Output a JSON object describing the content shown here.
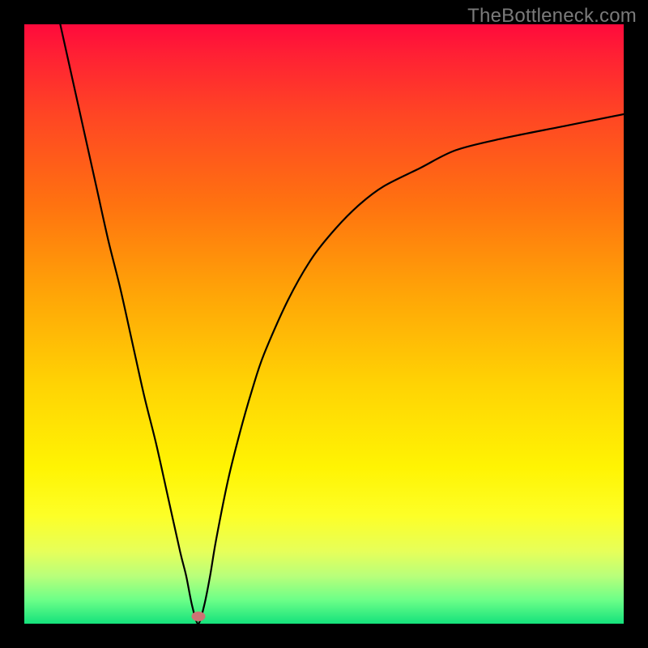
{
  "watermark": "TheBottleneck.com",
  "chart_data": {
    "type": "line",
    "title": "",
    "xlabel": "",
    "ylabel": "",
    "xlim": [
      0,
      100
    ],
    "ylim": [
      0,
      100
    ],
    "background": {
      "gradient": "vertical",
      "stops": [
        {
          "pos": 0.0,
          "color": "#ff0a3c"
        },
        {
          "pos": 0.05,
          "color": "#ff2034"
        },
        {
          "pos": 0.15,
          "color": "#ff4524"
        },
        {
          "pos": 0.3,
          "color": "#ff7210"
        },
        {
          "pos": 0.45,
          "color": "#ffa507"
        },
        {
          "pos": 0.6,
          "color": "#ffd304"
        },
        {
          "pos": 0.74,
          "color": "#fff403"
        },
        {
          "pos": 0.82,
          "color": "#fdff27"
        },
        {
          "pos": 0.88,
          "color": "#e6ff5a"
        },
        {
          "pos": 0.92,
          "color": "#b9ff7a"
        },
        {
          "pos": 0.96,
          "color": "#6dff88"
        },
        {
          "pos": 1.0,
          "color": "#14e27c"
        }
      ]
    },
    "series": [
      {
        "name": "curve",
        "color": "#000000",
        "x": [
          6,
          8,
          10,
          12,
          14,
          16,
          18,
          20,
          22,
          24,
          26,
          27,
          28,
          29,
          30,
          31,
          32,
          34,
          36,
          38,
          40,
          44,
          48,
          52,
          56,
          60,
          66,
          72,
          80,
          90,
          100
        ],
        "y": [
          100,
          91,
          82,
          73,
          64,
          56,
          47,
          38,
          30,
          21,
          12,
          8,
          3,
          0,
          3,
          8,
          14,
          24,
          32,
          39,
          45,
          54,
          61,
          66,
          70,
          73,
          76,
          79,
          81,
          83,
          85
        ]
      }
    ],
    "markers": [
      {
        "name": "min-dot",
        "x": 29,
        "y": 1.2,
        "color": "#cd7374"
      }
    ]
  }
}
